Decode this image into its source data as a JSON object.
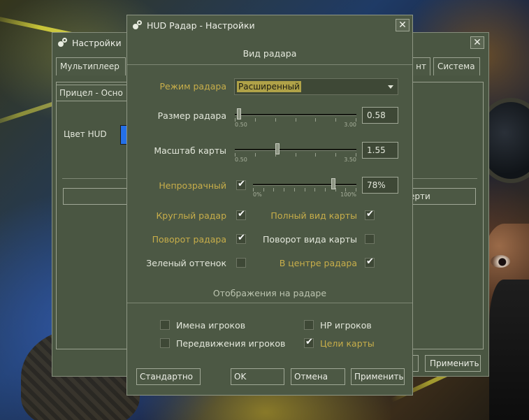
{
  "back_window": {
    "title": "Настройки",
    "close_glyph": "✕",
    "tabs": [
      {
        "label": "Мультиплеер"
      },
      {
        "label": "нт"
      },
      {
        "label": "Система"
      }
    ],
    "subtab": "Прицел - Осно",
    "hud_color_label": "Цвет HUD",
    "hud_color": "#2470e8",
    "partial_field": "ерти",
    "apply_label": "Применить"
  },
  "dialog": {
    "title": "HUD Радар - Настройки",
    "close_glyph": "✕",
    "section_view": "Вид радара",
    "radar_mode": {
      "label": "Режим радара",
      "value": "Расширенный"
    },
    "radar_size": {
      "label": "Размер радара",
      "value": "0.58",
      "min": "0.50",
      "max": "3.00",
      "fraction": 0.032
    },
    "map_scale": {
      "label": "Масштаб карты",
      "value": "1.55",
      "min": "0.50",
      "max": "3.50",
      "fraction": 0.35
    },
    "opacity": {
      "label": "Непрозрачный",
      "checked": true,
      "value": "78%",
      "min": "0%",
      "max": "100%",
      "fraction": 0.78
    },
    "options_left": [
      {
        "label": "Круглый радар",
        "checked": true,
        "color": "yellow"
      },
      {
        "label": "Поворот радара",
        "checked": true,
        "color": "yellow"
      },
      {
        "label": "Зеленый оттенок",
        "checked": false,
        "color": "white"
      }
    ],
    "options_right": [
      {
        "label": "Полный вид карты",
        "checked": true,
        "color": "yellow"
      },
      {
        "label": "Поворот вида карты",
        "checked": false,
        "color": "white"
      },
      {
        "label": "В центре радара",
        "checked": true,
        "color": "yellow"
      }
    ],
    "section_display": "Отображения на радаре",
    "display_left": [
      {
        "label": "Имена игроков",
        "checked": false,
        "color": "white"
      },
      {
        "label": "Передвижения игроков",
        "checked": false,
        "color": "white"
      }
    ],
    "display_right": [
      {
        "label": "HP игроков",
        "checked": false,
        "color": "white"
      },
      {
        "label": "Цели карты",
        "checked": true,
        "color": "yellow"
      }
    ],
    "buttons": {
      "default": "Стандартно",
      "ok": "OK",
      "cancel": "Отмена",
      "apply": "Применить"
    }
  }
}
